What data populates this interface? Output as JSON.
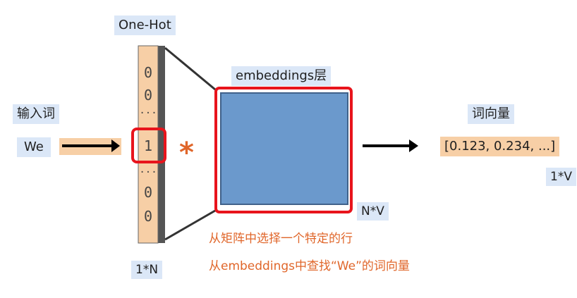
{
  "labels": {
    "one_hot": "One-Hot",
    "input_word": "输入词",
    "word": "We",
    "embeddings_layer": "embeddings层",
    "word_vector": "词向量",
    "vector_value": "[0.123, 0.234, ...]",
    "dim_1v": "1*V",
    "dim_nv": "N*V",
    "dim_1n": "1*N",
    "multiply": "*"
  },
  "one_hot_vector": {
    "digits_top": [
      "0",
      "0"
    ],
    "dots_top": "...",
    "selected": "1",
    "dots_bottom": "...",
    "digits_bottom": [
      "0",
      "0"
    ]
  },
  "captions": {
    "line1": "从矩阵中选择一个特定的行",
    "line2": "从embeddings中查找“We”的词向量"
  },
  "colors": {
    "orange_fill": "#f7cfa6",
    "highlight_red": "#e8141c",
    "matrix_fill": "#6b99cc",
    "caption_orange": "#e0662a",
    "label_blue_bg": "#dbe7f7"
  }
}
